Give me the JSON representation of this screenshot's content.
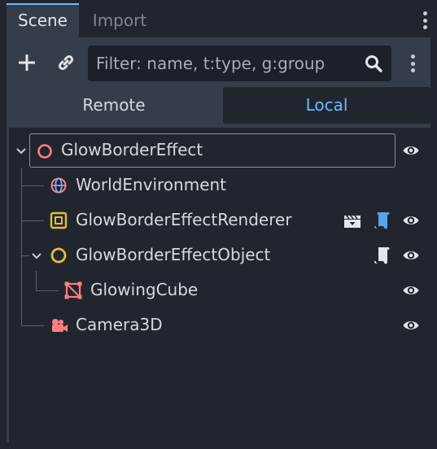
{
  "tabs": [
    {
      "label": "Scene",
      "active": true
    },
    {
      "label": "Import",
      "active": false
    }
  ],
  "toolbar": {
    "add_icon": "plus-icon",
    "link_icon": "link-icon",
    "filter_placeholder": "Filter: name, t:type, g:group",
    "search_icon": "search-icon",
    "menu_icon": "kebab-menu-icon"
  },
  "segments": {
    "remote": "Remote",
    "local": "Local",
    "selected": "Local"
  },
  "tree": {
    "nodes": [
      {
        "name": "GlowBorderEffect",
        "icon": "node3d-icon",
        "icon_color": "#fc7f7f",
        "expanded": true,
        "visible": true
      },
      {
        "name": "WorldEnvironment",
        "icon": "world-environment-icon",
        "icon_color": "#fc7f7f"
      },
      {
        "name": "GlowBorderEffectRenderer",
        "icon": "subviewport-container-icon",
        "icon_color": "#e0c03a",
        "badges": [
          "clapperboard-icon",
          "script-icon"
        ],
        "visible": true
      },
      {
        "name": "GlowBorderEffectObject",
        "icon": "node2d-ring-icon",
        "icon_color": "#e0c03a",
        "expanded": true,
        "badges": [
          "script-icon"
        ],
        "visible": true
      },
      {
        "name": "GlowingCube",
        "icon": "mesh-instance-icon",
        "icon_color": "#fc7f7f",
        "visible": true
      },
      {
        "name": "Camera3D",
        "icon": "camera3d-icon",
        "icon_color": "#fc7f7f",
        "visible": true
      }
    ]
  },
  "colors": {
    "accent": "#70bafa",
    "panel_bg": "#363d4a",
    "dark_bg": "#21262e",
    "node3d": "#fc7f7f",
    "control": "#e0c03a"
  }
}
